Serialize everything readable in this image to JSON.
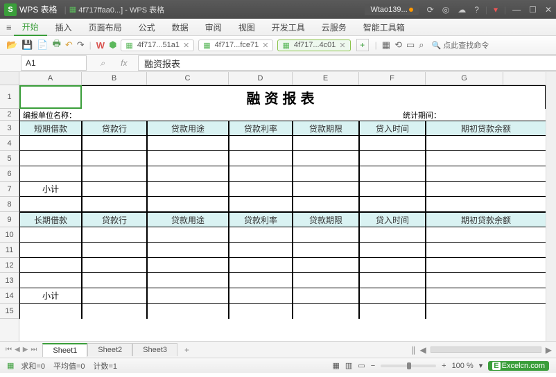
{
  "titlebar": {
    "app_letter": "S",
    "app_name": "WPS 表格",
    "doc_title": "4f717ffaa0...] - WPS 表格",
    "user": "Wtao139...",
    "icons": {
      "refresh": "⟳",
      "target": "◎",
      "cloud": "☁",
      "help": "?",
      "skin": "▾",
      "min": "—",
      "max": "☐",
      "close": "✕"
    }
  },
  "menubar": {
    "items": [
      "开始",
      "插入",
      "页面布局",
      "公式",
      "数据",
      "审阅",
      "视图",
      "开发工具",
      "云服务",
      "智能工具箱"
    ]
  },
  "toolbar": {
    "doc_tabs": [
      {
        "label": "4f717...51a1",
        "active": false
      },
      {
        "label": "4f717...fce71",
        "active": false
      },
      {
        "label": "4f717...4c01",
        "active": true
      }
    ],
    "search_placeholder": "点此查找命令"
  },
  "formula_bar": {
    "name_box": "A1",
    "fx": "fx",
    "content": "融资报表"
  },
  "columns": [
    "A",
    "B",
    "C",
    "D",
    "E",
    "F",
    "G"
  ],
  "rows": [
    "1",
    "2",
    "3",
    "4",
    "5",
    "6",
    "7",
    "8",
    "9",
    "10",
    "11",
    "12",
    "13",
    "14",
    "15"
  ],
  "sheet": {
    "title": "融资报表",
    "unit_label": "编报单位名称：",
    "period_label": "统计期间：",
    "headers1": [
      "短期借款",
      "贷款行",
      "贷款用途",
      "贷款利率",
      "贷款期限",
      "贷入时间",
      "期初贷款余额"
    ],
    "subtotal1": "小计",
    "headers2": [
      "长期借款",
      "贷款行",
      "贷款用途",
      "贷款利率",
      "贷款期限",
      "贷入时间",
      "期初贷款余额"
    ],
    "subtotal2": "小计"
  },
  "sheet_tabs": [
    "Sheet1",
    "Sheet2",
    "Sheet3"
  ],
  "status": {
    "sum": "求和=0",
    "avg": "平均值=0",
    "count": "计数=1",
    "zoom": "100 %",
    "brand": "Excelcn.com"
  }
}
